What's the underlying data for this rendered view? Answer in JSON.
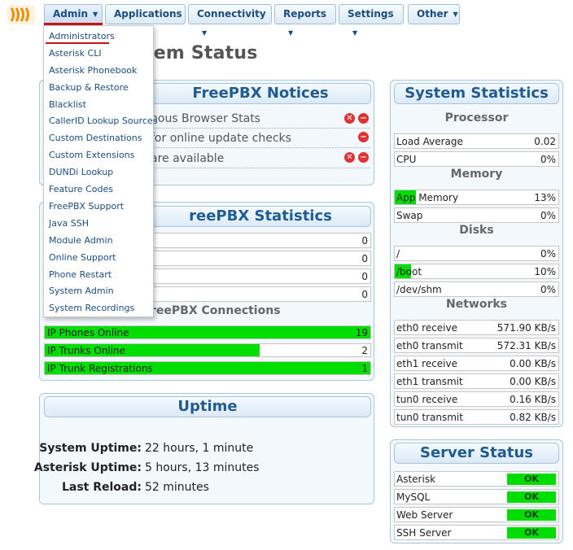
{
  "nav": {
    "items": [
      {
        "label": "Admin"
      },
      {
        "label": "Applications"
      },
      {
        "label": "Connectivity"
      },
      {
        "label": "Reports"
      },
      {
        "label": "Settings"
      },
      {
        "label": "Other"
      }
    ],
    "dropdown": [
      "Administrators",
      "Asterisk CLI",
      "Asterisk Phonebook",
      "Backup & Restore",
      "Blacklist",
      "CallerID Lookup Sources",
      "Custom Destinations",
      "Custom Extensions",
      "DUNDi Lookup",
      "Feature Codes",
      "FreePBX Support",
      "Java SSH",
      "Module Admin",
      "Online Support",
      "Phone Restart",
      "System Admin",
      "System Recordings"
    ]
  },
  "page": {
    "title_visible": "tem Status"
  },
  "notices": {
    "title_visible": "FreePBX Notices",
    "items": [
      {
        "text": "nous Browser Stats",
        "delete": true
      },
      {
        "text": "for online update checks",
        "delete": false
      },
      {
        "text": "are available",
        "delete": true
      }
    ]
  },
  "stats": {
    "title_visible": "reePBX Statistics",
    "values": [
      "0",
      "0",
      "0",
      "0"
    ]
  },
  "connections": {
    "title_visible": "reePBX Connections",
    "rows": [
      {
        "label": "IP Phones Online",
        "value": "19",
        "fill": 1.0
      },
      {
        "label": "IP Trunks Online",
        "value": "2",
        "fill": 0.66
      },
      {
        "label": "IP Trunk Registrations",
        "value": "1",
        "fill": 1.0
      }
    ]
  },
  "uptime": {
    "title": "Uptime",
    "system_label": "System Uptime:",
    "system_value": "22 hours, 1 minute",
    "asterisk_label": "Asterisk Uptime:",
    "asterisk_value": "5 hours, 13 minutes",
    "reload_label": "Last Reload:",
    "reload_value": "52 minutes"
  },
  "system_stats": {
    "title": "System Statistics",
    "processor": {
      "heading": "Processor",
      "rows": [
        {
          "label": "Load Average",
          "value": "0.02",
          "fill": 0
        },
        {
          "label": "CPU",
          "value": "0%",
          "fill": 0
        }
      ]
    },
    "memory": {
      "heading": "Memory",
      "rows": [
        {
          "label": "App Memory",
          "value": "13%",
          "fill": 0.13
        },
        {
          "label": "Swap",
          "value": "0%",
          "fill": 0
        }
      ]
    },
    "disks": {
      "heading": "Disks",
      "rows": [
        {
          "label": "/",
          "value": "0%",
          "fill": 0
        },
        {
          "label": "/boot",
          "value": "10%",
          "fill": 0.1
        },
        {
          "label": "/dev/shm",
          "value": "0%",
          "fill": 0
        }
      ]
    },
    "networks": {
      "heading": "Networks",
      "rows": [
        {
          "label": "eth0 receive",
          "value": "571.90 KB/s"
        },
        {
          "label": "eth0 transmit",
          "value": "572.31 KB/s"
        },
        {
          "label": "eth1 receive",
          "value": "0.00 KB/s"
        },
        {
          "label": "eth1 transmit",
          "value": "0.00 KB/s"
        },
        {
          "label": "tun0 receive",
          "value": "0.16 KB/s"
        },
        {
          "label": "tun0 transmit",
          "value": "0.82 KB/s"
        }
      ]
    }
  },
  "server_status": {
    "title": "Server Status",
    "rows": [
      {
        "label": "Asterisk",
        "status": "OK"
      },
      {
        "label": "MySQL",
        "status": "OK"
      },
      {
        "label": "Web Server",
        "status": "OK"
      },
      {
        "label": "SSH Server",
        "status": "OK"
      }
    ]
  },
  "colors": {
    "accent": "#1f5c94",
    "ok": "#00dd00",
    "alert": "#dd3333"
  }
}
